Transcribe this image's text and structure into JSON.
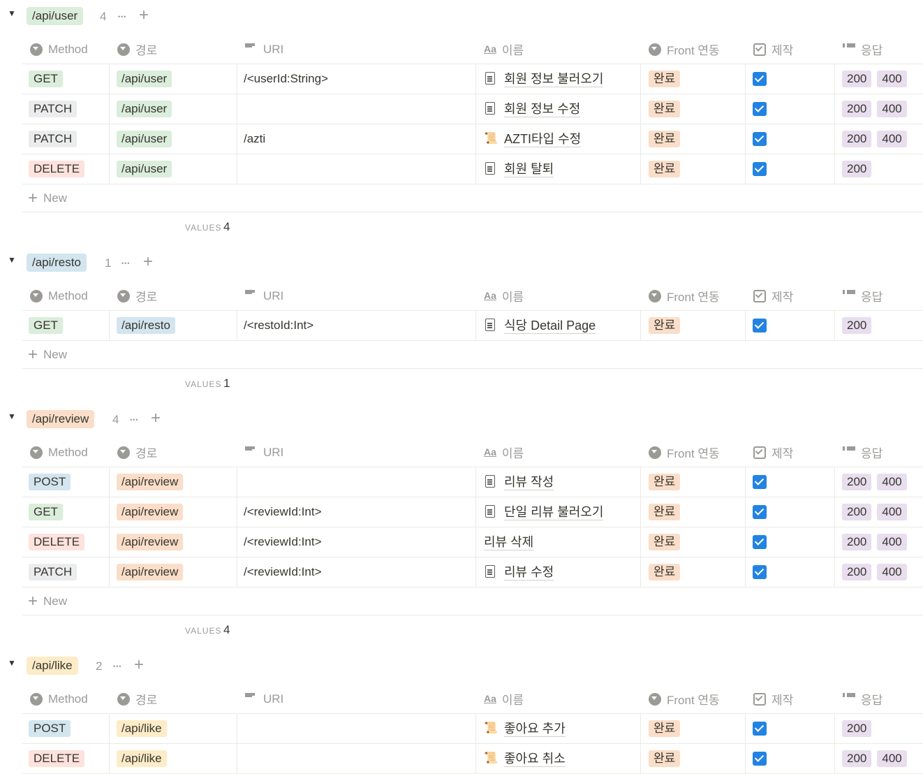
{
  "headers": {
    "method": "Method",
    "path": "경로",
    "uri": "URI",
    "name_icon": "Aa",
    "name": "이름",
    "front": "Front 연동",
    "make": "제작",
    "response": "응답"
  },
  "new_label": "New",
  "values_label": "VALUES",
  "groups": [
    {
      "tag": "/api/user",
      "tag_color": "#dbeddb",
      "count": "4",
      "values_count": "4",
      "rows": [
        {
          "method": "GET",
          "method_color": "green",
          "path": "/api/user",
          "uri": "/<userId:String>",
          "icon": "document-icon",
          "name": "회원 정보 불러오기",
          "front": "완료",
          "checked": true,
          "responses": [
            "200",
            "400"
          ]
        },
        {
          "method": "PATCH",
          "method_color": "gray",
          "path": "/api/user",
          "uri": "",
          "icon": "document-icon",
          "name": "회원 정보 수정",
          "front": "완료",
          "checked": true,
          "responses": [
            "200",
            "400"
          ]
        },
        {
          "method": "PATCH",
          "method_color": "gray",
          "path": "/api/user",
          "uri": "/azti",
          "icon": "scroll-icon",
          "name": "AZTI타입 수정",
          "front": "완료",
          "checked": true,
          "responses": [
            "200",
            "400"
          ]
        },
        {
          "method": "DELETE",
          "method_color": "red",
          "path": "/api/user",
          "uri": "",
          "icon": "document-icon",
          "name": "회원 탈퇴",
          "front": "완료",
          "checked": true,
          "responses": [
            "200"
          ]
        }
      ]
    },
    {
      "tag": "/api/resto",
      "tag_color": "#d3e5ef",
      "count": "1",
      "values_count": "1",
      "rows": [
        {
          "method": "GET",
          "method_color": "green",
          "path": "/api/resto",
          "uri": "/<restoId:Int>",
          "icon": "document-icon",
          "name": "식당 Detail Page",
          "front": "완료",
          "checked": true,
          "responses": [
            "200"
          ]
        }
      ]
    },
    {
      "tag": "/api/review",
      "tag_color": "#fadec9",
      "count": "4",
      "values_count": "4",
      "rows": [
        {
          "method": "POST",
          "method_color": "blue",
          "path": "/api/review",
          "uri": "",
          "icon": "document-icon",
          "name": "리뷰 작성",
          "front": "완료",
          "checked": true,
          "responses": [
            "200",
            "400"
          ]
        },
        {
          "method": "GET",
          "method_color": "green",
          "path": "/api/review",
          "uri": "/<reviewId:Int>",
          "icon": "document-icon",
          "name": "단일 리뷰 불러오기",
          "front": "완료",
          "checked": true,
          "responses": [
            "200",
            "400"
          ]
        },
        {
          "method": "DELETE",
          "method_color": "red",
          "path": "/api/review",
          "uri": "/<reviewId:Int>",
          "icon": "",
          "name": "리뷰 삭제",
          "front": "완료",
          "checked": true,
          "responses": [
            "200",
            "400"
          ]
        },
        {
          "method": "PATCH",
          "method_color": "gray",
          "path": "/api/review",
          "uri": "/<reviewId:Int>",
          "icon": "document-icon",
          "name": "리뷰 수정",
          "front": "완료",
          "checked": true,
          "responses": [
            "200",
            "400"
          ]
        }
      ]
    },
    {
      "tag": "/api/like",
      "tag_color": "#fdecc8",
      "count": "2",
      "values_count": "",
      "rows": [
        {
          "method": "POST",
          "method_color": "blue",
          "path": "/api/like",
          "uri": "",
          "icon": "scroll-icon",
          "name": "좋아요 추가",
          "front": "완료",
          "checked": true,
          "responses": [
            "200"
          ]
        },
        {
          "method": "DELETE",
          "method_color": "red",
          "path": "/api/like",
          "uri": "",
          "icon": "scroll-icon",
          "name": "좋아요 취소",
          "front": "완료",
          "checked": true,
          "responses": [
            "200",
            "400"
          ]
        }
      ]
    }
  ]
}
